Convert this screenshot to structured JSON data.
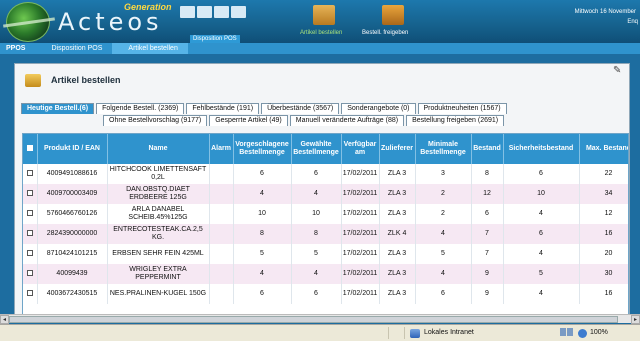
{
  "header": {
    "logo_text": "Acteos",
    "logo_tagline": "Generation",
    "nav_label": "Disposition POS",
    "action1_label": "Artikel bestellen",
    "action2_label": "Bestell. freigeben",
    "date": "Mittwoch 16 November",
    "enq": "Enq"
  },
  "breadcrumb": [
    "PPOS",
    "Disposition POS",
    "Artikel bestellen"
  ],
  "panel": {
    "title": "Artikel bestellen"
  },
  "tabs_row1": [
    {
      "label": "Heutige Bestell.(6)",
      "active": true
    },
    {
      "label": "Folgende Bestell. (2369)",
      "active": false
    },
    {
      "label": "Fehlbestände (191)",
      "active": false
    },
    {
      "label": "Überbestände (3567)",
      "active": false
    },
    {
      "label": "Sonderangebote (0)",
      "active": false
    },
    {
      "label": "Produktneuheiten (1567)",
      "active": false
    }
  ],
  "tabs_row2": [
    {
      "label": "Ohne Bestellvorschlag (9177)"
    },
    {
      "label": "Gesperrte Artikel (49)"
    },
    {
      "label": "Manuell veränderte Aufträge (88)"
    },
    {
      "label": "Bestellung freigeben (2691)"
    }
  ],
  "table": {
    "headers": [
      "",
      "Produkt ID / EAN",
      "Name",
      "Alarm",
      "Vorgeschlagene Bestellmenge",
      "Gewählte Bestellmenge",
      "Verfügbar am",
      "Zulieferer",
      "Minimale Bestellmenge",
      "Bestand",
      "Sicherheitsbestand",
      "Max. Bestand"
    ],
    "rows": [
      {
        "ean": "4009491088616",
        "name": "HITCHCOOK LIMETTENSAFT 0,2L",
        "alarm": "",
        "proposed": "6",
        "chosen": "6",
        "date": "17/02/2011",
        "supplier": "ZLA 3",
        "min": "3",
        "stock": "8",
        "safety": "6",
        "max": "22"
      },
      {
        "ean": "4009700003409",
        "name": "DAN.OBSTQ.DIAET ERDBEERE 125G",
        "alarm": "",
        "proposed": "4",
        "chosen": "4",
        "date": "17/02/2011",
        "supplier": "ZLA 3",
        "min": "2",
        "stock": "12",
        "safety": "10",
        "max": "34"
      },
      {
        "ean": "5760466760126",
        "name": "ARLA DANABEL SCHEIB.45%125G",
        "alarm": "",
        "proposed": "10",
        "chosen": "10",
        "date": "17/02/2011",
        "supplier": "ZLA 3",
        "min": "2",
        "stock": "6",
        "safety": "4",
        "max": "12"
      },
      {
        "ean": "2824390000000",
        "name": "ENTRECOTESTEAK.CA.2,5 KG.",
        "alarm": "",
        "proposed": "8",
        "chosen": "8",
        "date": "17/02/2011",
        "supplier": "ZLK 4",
        "min": "4",
        "stock": "7",
        "safety": "6",
        "max": "16"
      },
      {
        "ean": "8710424101215",
        "name": "ERBSEN SEHR FEIN 425ML",
        "alarm": "",
        "proposed": "5",
        "chosen": "5",
        "date": "17/02/2011",
        "supplier": "ZLA 3",
        "min": "5",
        "stock": "7",
        "safety": "4",
        "max": "20"
      },
      {
        "ean": "40099439",
        "name": "WRIGLEY EXTRA PEPPERMINT",
        "alarm": "",
        "proposed": "4",
        "chosen": "4",
        "date": "17/02/2011",
        "supplier": "ZLA 3",
        "min": "4",
        "stock": "9",
        "safety": "5",
        "max": "30"
      },
      {
        "ean": "4003672430515",
        "name": "NES.PRALINEN-KUGEL 150G",
        "alarm": "",
        "proposed": "6",
        "chosen": "6",
        "date": "17/02/2011",
        "supplier": "ZLA 3",
        "min": "6",
        "stock": "9",
        "safety": "4",
        "max": "16"
      }
    ]
  },
  "statusbar": {
    "zone": "Lokales Intranet",
    "zoom": "100%"
  }
}
